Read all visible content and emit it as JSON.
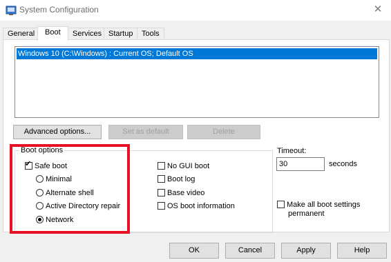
{
  "window": {
    "title": "System Configuration",
    "close_glyph": "✕"
  },
  "tabs": [
    {
      "label": "General"
    },
    {
      "label": "Boot"
    },
    {
      "label": "Services"
    },
    {
      "label": "Startup"
    },
    {
      "label": "Tools"
    }
  ],
  "active_tab": "Boot",
  "os_list": {
    "items": [
      "Windows 10 (C:\\Windows) : Current OS; Default OS"
    ],
    "selected_index": 0
  },
  "actions": {
    "advanced": "Advanced options...",
    "set_default": "Set as default",
    "delete": "Delete"
  },
  "boot_options": {
    "label": "Boot options",
    "safe_boot": {
      "label": "Safe boot",
      "checked": true
    },
    "safe_modes": [
      {
        "label": "Minimal",
        "selected": false
      },
      {
        "label": "Alternate shell",
        "selected": false
      },
      {
        "label": "Active Directory repair",
        "selected": false
      },
      {
        "label": "Network",
        "selected": true
      }
    ],
    "right_checks": [
      {
        "label": "No GUI boot",
        "checked": false
      },
      {
        "label": "Boot log",
        "checked": false
      },
      {
        "label": "Base video",
        "checked": false
      },
      {
        "label": "OS boot information",
        "checked": false
      }
    ]
  },
  "timeout": {
    "label": "Timeout:",
    "value": "30",
    "unit": "seconds"
  },
  "make_permanent": {
    "line1": "Make all boot settings",
    "line2": "permanent",
    "checked": false
  },
  "buttons": {
    "ok": "OK",
    "cancel": "Cancel",
    "apply": "Apply",
    "help": "Help"
  },
  "colors": {
    "selection": "#0078d7",
    "highlight": "#e81123"
  }
}
